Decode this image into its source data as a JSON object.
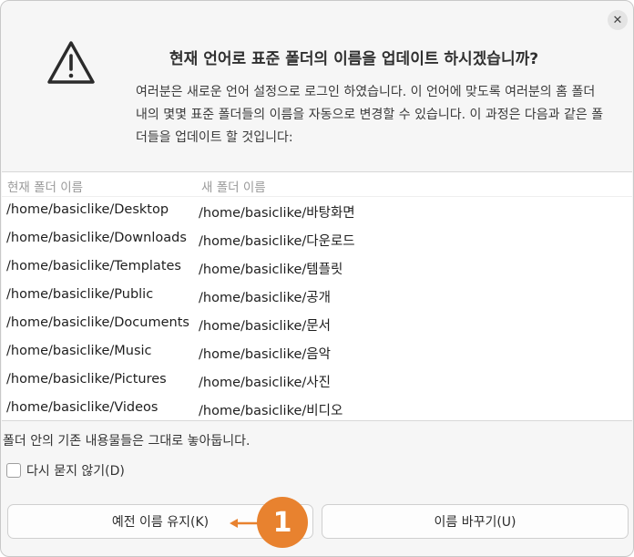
{
  "dialog": {
    "title": "현재 언어로 표준 폴더의 이름을 업데이트 하시겠습니까?",
    "description": "여러분은 새로운 언어 설정으로 로그인 하였습니다. 이 언어에 맞도록 여러분의 홈 폴더 내의 몇몇 표준 폴더들의 이름을 자동으로 변경할 수 있습니다. 이 과정은 다음과 같은 폴더들을 업데이트 할 것입니다:",
    "close_glyph": "✕"
  },
  "list": {
    "headers": [
      "현재 폴더 이름",
      "새 폴더 이름"
    ],
    "rows": [
      {
        "current": "/home/basiclike/Desktop",
        "new": "/home/basiclike/바탕화면"
      },
      {
        "current": "/home/basiclike/Downloads",
        "new": "/home/basiclike/다운로드"
      },
      {
        "current": "/home/basiclike/Templates",
        "new": "/home/basiclike/템플릿"
      },
      {
        "current": "/home/basiclike/Public",
        "new": "/home/basiclike/공개"
      },
      {
        "current": "/home/basiclike/Documents",
        "new": "/home/basiclike/문서"
      },
      {
        "current": "/home/basiclike/Music",
        "new": "/home/basiclike/음악"
      },
      {
        "current": "/home/basiclike/Pictures",
        "new": "/home/basiclike/사진"
      },
      {
        "current": "/home/basiclike/Videos",
        "new": "/home/basiclike/비디오"
      }
    ]
  },
  "note": "폴더 안의 기존 내용물들은 그대로 놓아둡니다.",
  "checkbox": {
    "label": "다시 묻지 않기(D)",
    "checked": false
  },
  "buttons": {
    "keep": "예전 이름 유지(K)",
    "rename": "이름 바꾸기(U)"
  },
  "annotation": {
    "number": "1",
    "color": "#e8822f"
  },
  "icons": {
    "warning": "warning-triangle-icon",
    "close": "close-icon",
    "arrow": "arrow-left-icon"
  }
}
